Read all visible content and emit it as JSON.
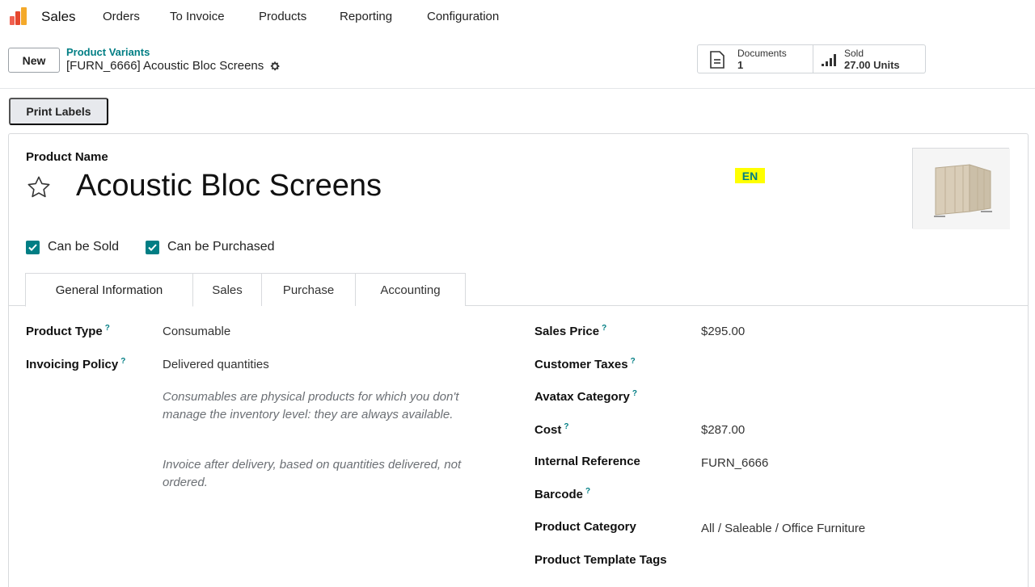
{
  "nav": {
    "app": "Sales",
    "items": [
      "Orders",
      "To Invoice",
      "Products",
      "Reporting",
      "Configuration"
    ]
  },
  "control": {
    "new_label": "New",
    "breadcrumb_parent": "Product Variants",
    "breadcrumb_current": "[FURN_6666] Acoustic Bloc Screens",
    "print_labels": "Print Labels"
  },
  "smart_buttons": {
    "documents": {
      "title": "Documents",
      "value": "1"
    },
    "sold": {
      "title": "Sold",
      "value": "27.00 Units"
    }
  },
  "form": {
    "product_name_label": "Product Name",
    "product_name": "Acoustic Bloc Screens",
    "lang": "EN",
    "can_be_sold": "Can be Sold",
    "can_be_purchased": "Can be Purchased"
  },
  "tabs": [
    "General Information",
    "Sales",
    "Purchase",
    "Accounting"
  ],
  "left_fields": {
    "product_type_label": "Product Type",
    "product_type": "Consumable",
    "invoicing_policy_label": "Invoicing Policy",
    "invoicing_policy": "Delivered quantities",
    "help_consumable": "Consumables are physical products for which you don't manage the inventory level: they are always available.",
    "help_invoice": "Invoice after delivery, based on quantities delivered, not ordered."
  },
  "right_fields": {
    "sales_price_label": "Sales Price",
    "sales_price": "$295.00",
    "customer_taxes_label": "Customer Taxes",
    "avatax_label": "Avatax Category",
    "cost_label": "Cost",
    "cost": "$287.00",
    "internal_ref_label": "Internal Reference",
    "internal_ref": "FURN_6666",
    "barcode_label": "Barcode",
    "category_label": "Product Category",
    "category": "All / Saleable / Office Furniture",
    "template_tags_label": "Product Template Tags"
  },
  "colors": {
    "accent": "#017e84",
    "highlight": "#ffff00"
  }
}
